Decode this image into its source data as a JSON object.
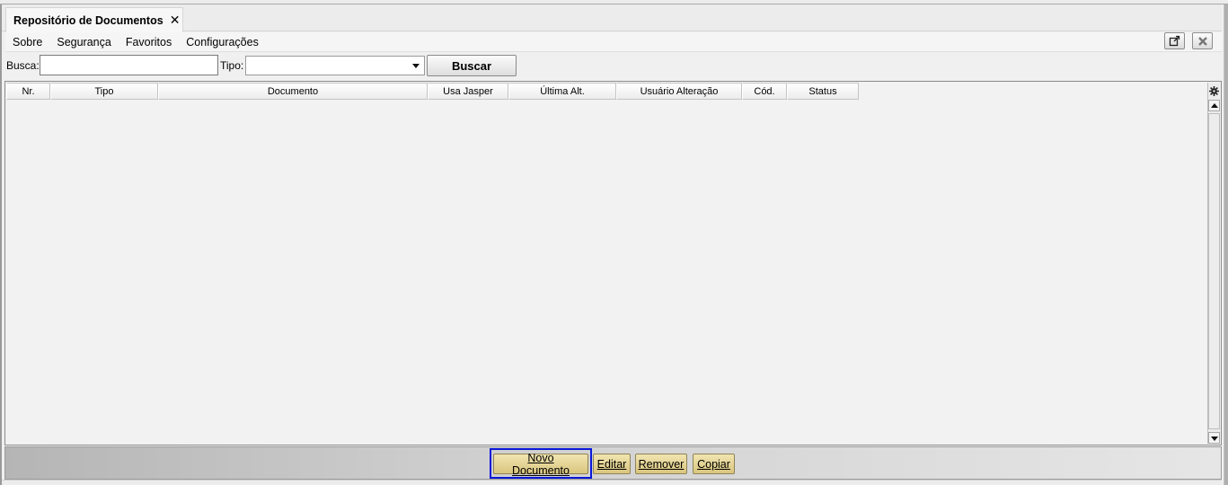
{
  "tab": {
    "title": "Repositório de Documentos",
    "close_glyph": "✕"
  },
  "menu": {
    "items": [
      "Sobre",
      "Segurança",
      "Favoritos",
      "Configurações"
    ]
  },
  "search": {
    "busca_label": "Busca:",
    "busca_value": "",
    "tipo_label": "Tipo:",
    "tipo_value": "",
    "button_label": "Buscar"
  },
  "grid": {
    "columns": [
      "Nr.",
      "Tipo",
      "Documento",
      "Usa Jasper",
      "Última Alt.",
      "Usuário Alteração",
      "Cód.",
      "Status"
    ],
    "rows": []
  },
  "actions": {
    "novo": "Novo Documento",
    "editar": "Editar",
    "remover": "Remover",
    "copiar": "Copiar"
  },
  "icons": {
    "detach": "external-window-icon",
    "close": "close-icon",
    "settings": "gear-icon"
  },
  "colors": {
    "focus": "#0a18d8",
    "button_bg": "#e6d495",
    "background": "#f0f0f0"
  }
}
